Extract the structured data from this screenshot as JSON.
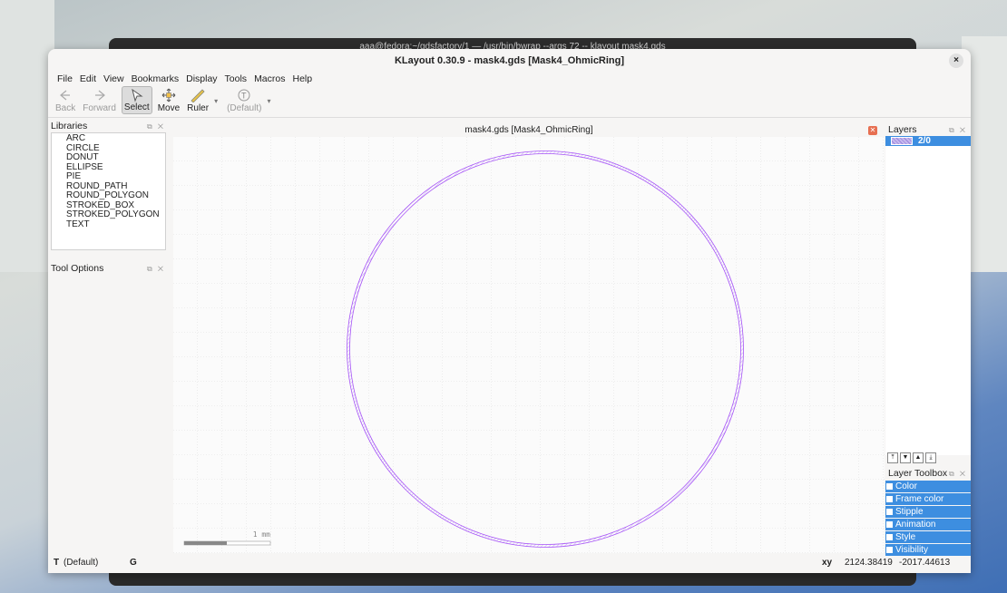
{
  "terminal": {
    "title": "aaa@fedora:~/gdsfactory/1 — /usr/bin/bwrap --args 72 -- klayout mask4.gds"
  },
  "window": {
    "title": "KLayout 0.30.9 - mask4.gds [Mask4_OhmicRing]",
    "close": "×"
  },
  "menu": [
    "File",
    "Edit",
    "View",
    "Bookmarks",
    "Display",
    "Tools",
    "Macros",
    "Help"
  ],
  "toolbar": {
    "back": "Back",
    "forward": "Forward",
    "select": "Select",
    "move": "Move",
    "ruler": "Ruler",
    "default": "(Default)",
    "text_glyph": "T"
  },
  "libraries": {
    "title": "Libraries",
    "items": [
      "ARC",
      "CIRCLE",
      "DONUT",
      "ELLIPSE",
      "PIE",
      "ROUND_PATH",
      "ROUND_POLYGON",
      "STROKED_BOX",
      "STROKED_POLYGON",
      "TEXT"
    ]
  },
  "tool_options": {
    "title": "Tool Options"
  },
  "canvas": {
    "title": "mask4.gds [Mask4_OhmicRing]",
    "scale_label": "1 mm",
    "ring_color": "#a855f7"
  },
  "layers": {
    "title": "Layers",
    "items": [
      {
        "name": "2/0",
        "color": "#9a85dc"
      }
    ]
  },
  "layer_toolbox": {
    "title": "Layer Toolbox",
    "items": [
      "Color",
      "Frame color",
      "Stipple",
      "Animation",
      "Style",
      "Visibility"
    ],
    "accent": "#3d8ee0"
  },
  "status": {
    "mode_t": "T",
    "mode_label": "(Default)",
    "mode_g": "G",
    "coord_label": "xy",
    "x": "2124.38419",
    "y": "-2017.44613"
  },
  "panel_buttons": "⧉ ✕"
}
